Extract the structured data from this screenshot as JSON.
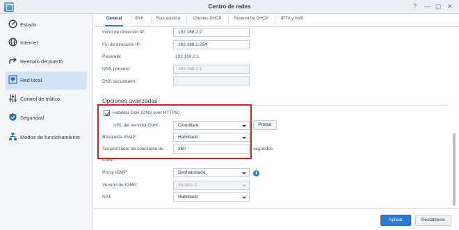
{
  "window": {
    "title": "Centro de redes",
    "controls": [
      "?",
      "—",
      "▢",
      "✕"
    ]
  },
  "sidebar": {
    "items": [
      {
        "label": "Estado",
        "icon": "dashboard-icon"
      },
      {
        "label": "Internet",
        "icon": "globe-icon"
      },
      {
        "label": "Reenvío de puerto",
        "icon": "forward-arrow-icon"
      },
      {
        "label": "Red local",
        "icon": "local-network-icon",
        "active": true
      },
      {
        "label": "Control de tráfico",
        "icon": "sliders-icon"
      },
      {
        "label": "Seguridad",
        "icon": "shield-icon"
      },
      {
        "label": "Modos de funcionamiento",
        "icon": "network-nodes-icon"
      }
    ]
  },
  "tabs": [
    "General",
    "IPv6",
    "Ruta estática",
    "Clientes DHCP",
    "Reserva de DHCP",
    "IPTV y VoIP"
  ],
  "form": {
    "start_ip_label": "Inicio de dirección IP:",
    "start_ip_value": "192.168.2.2",
    "end_ip_label": "Fin de dirección IP:",
    "end_ip_value": "192.168.2.254",
    "gateway_label": "Pasarela:",
    "gateway_value": "192.168.2.1",
    "dns_primary_label": "DNS primario:",
    "dns_primary_value": "192.168.2.1",
    "dns_secondary_label": "DNS secundario:",
    "dns_secondary_value": "",
    "advanced_title": "Opciones avanzadas",
    "doh_label": "Habilitar DoH (DNS over HTTPS)",
    "doh_checked": true,
    "doh_url_label": "URL del servidor DoH:",
    "doh_url_value": "Cloudflare",
    "test_button": "Probar",
    "igmp_search_label": "Búsqueda IGMP:",
    "igmp_search_value": "Habilitado",
    "igmp_timer_label_1": "Temporizador de solicitante de",
    "igmp_timer_label_2": "IGMP:",
    "igmp_timer_suffix": "segundos",
    "igmp_timer_value": "260",
    "igmp_proxy_label": "Proxy IGMP:",
    "igmp_proxy_value": "Deshabilitado",
    "igmp_version_label": "Versión de IGMP:",
    "igmp_version_value": "Versión 2",
    "nat_label": "NAT:",
    "nat_value": "Habilitado"
  },
  "footer": {
    "apply": "Aplicar",
    "reset": "Restablecer"
  },
  "colors": {
    "accent": "#2d7ad1",
    "highlight_box": "#cc2222",
    "active_nav": "#d2e3f5"
  }
}
